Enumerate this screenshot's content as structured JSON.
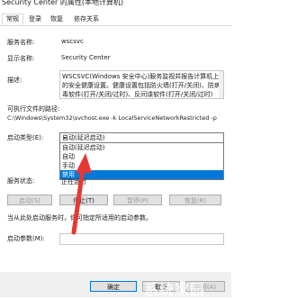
{
  "window": {
    "title": "Security Center 的属性(本地计算机)"
  },
  "tabs": [
    {
      "label": "常规"
    },
    {
      "label": "登录"
    },
    {
      "label": "恢复"
    },
    {
      "label": "依存关系"
    }
  ],
  "fields": {
    "service_name_label": "服务名称:",
    "service_name_value": "wscsvc",
    "display_name_label": "显示名称:",
    "display_name_value": "Security Center",
    "description_label": "描述:",
    "description_text": "WSCSVC(Windows 安全中心)服务监视并报告计算机上的安全健康设置。健康设置包括防火墙(打开/关闭)、防病毒软件(打开/关闭/过时)、反间谍软件(打开/关闭/过时)",
    "exe_path_label": "可执行文件的路径:",
    "exe_path_value": "C:\\Windows\\System32\\svchost.exe -k LocalServiceNetworkRestricted -p",
    "startup_type_label": "启动类型(E):",
    "startup_type_value": "自动(延迟启动)",
    "startup_options": [
      "自动(延迟启动)",
      "自动",
      "手动",
      "禁用"
    ],
    "startup_selected_index": 3,
    "service_status_label": "服务状态:",
    "service_status_value": "正在运行"
  },
  "buttons": {
    "start": "启动(S)",
    "stop": "停止(T)",
    "pause": "暂停(P)",
    "resume": "恢复(R)",
    "ok": "确定",
    "cancel": "取消",
    "apply": "应用(A)"
  },
  "hint_text": "当从此处启动服务时，你可指定所适用的启动参数。",
  "param_label": "启动参数(M):",
  "param_value": "",
  "watermark": "系统家园",
  "colors": {
    "selection": "#0078d7",
    "arrow": "#e53935"
  }
}
